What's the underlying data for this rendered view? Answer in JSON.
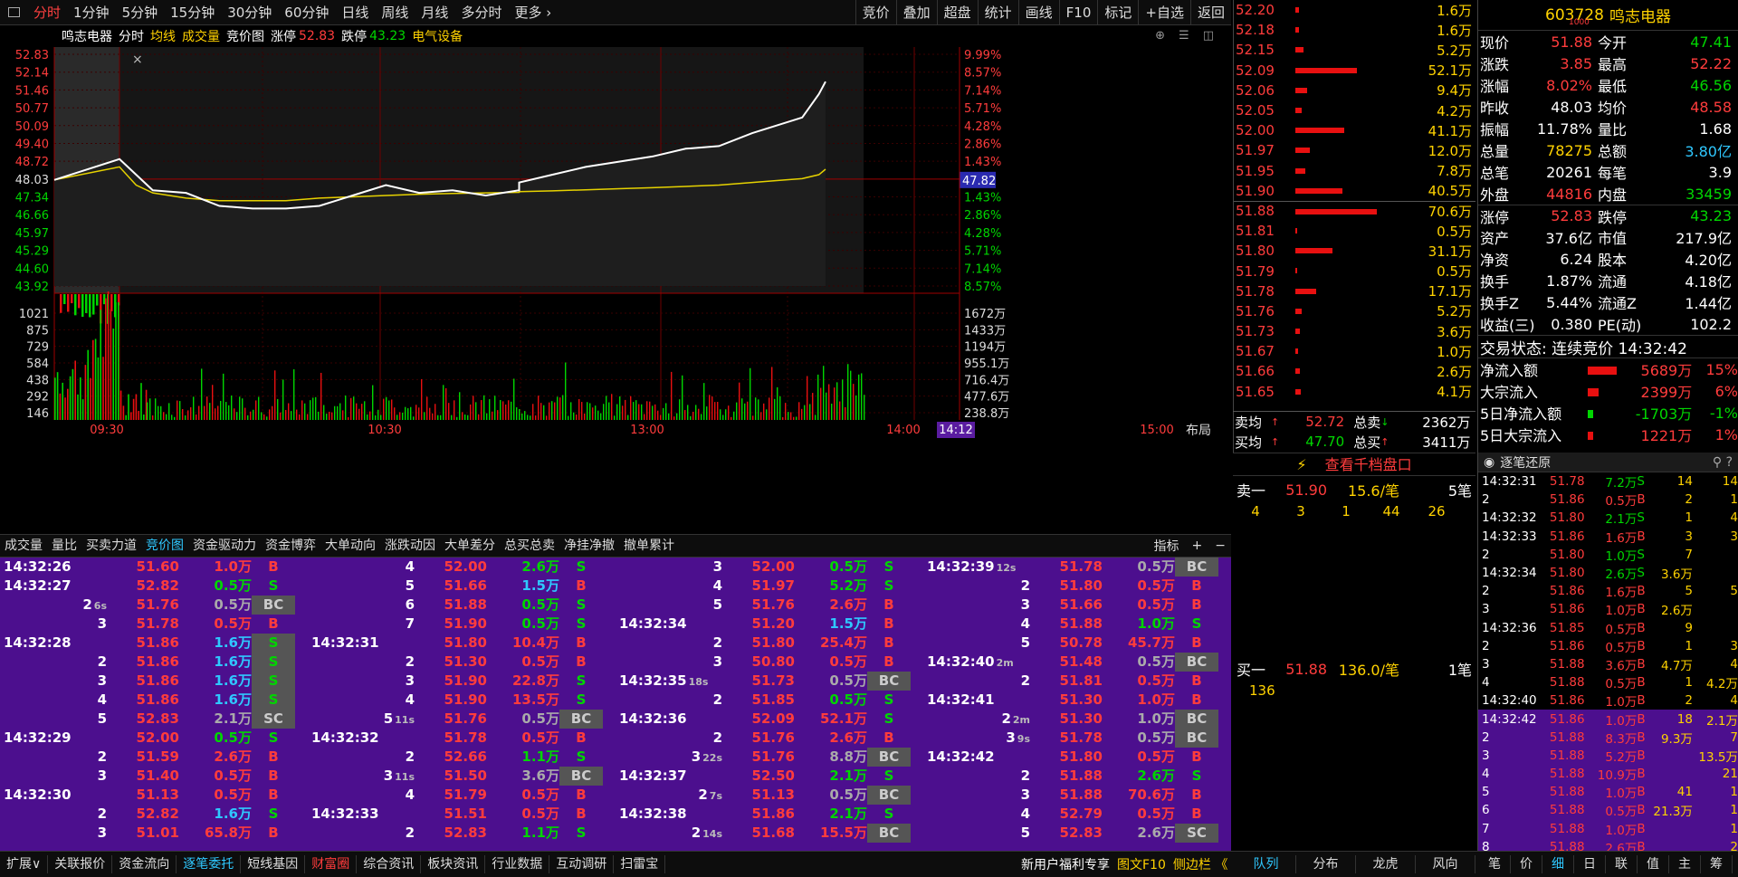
{
  "topbar": {
    "tabs": [
      "分时",
      "1分钟",
      "5分钟",
      "15分钟",
      "30分钟",
      "60分钟",
      "日线",
      "周线",
      "月线",
      "多分时",
      "更多"
    ],
    "right_tabs": [
      "竞价",
      "叠加",
      "超盘",
      "统计",
      "画线",
      "F10",
      "标记",
      "+自选",
      "返回"
    ]
  },
  "infoline": {
    "name": "鸣志电器",
    "mode": "分时",
    "avg_label": "均线",
    "vol_label": "成交量",
    "auction_label": "竞价图",
    "zt_label": "涨停",
    "zt_value": "52.83",
    "dt_label": "跌停",
    "dt_value": "43.23",
    "sector": "电气设备"
  },
  "chart": {
    "left_prices": [
      "52.83",
      "52.14",
      "51.46",
      "50.77",
      "50.09",
      "49.40",
      "48.72",
      "48.03",
      "47.34",
      "46.66",
      "45.97",
      "45.29",
      "44.60",
      "43.92"
    ],
    "right_pct": [
      "9.99%",
      "8.57%",
      "7.14%",
      "5.71%",
      "4.28%",
      "2.86%",
      "1.43%",
      "",
      "1.43%",
      "2.86%",
      "4.28%",
      "5.71%",
      "7.14%",
      "8.57%"
    ],
    "current_price_tag": "47.82",
    "vol_left": [
      "1021",
      "875",
      "729",
      "584",
      "438",
      "292",
      "146"
    ],
    "vol_right": [
      "1672万",
      "1433万",
      "1194万",
      "955.1万",
      "716.4万",
      "477.6万",
      "238.8万"
    ],
    "time_labels": [
      "09:30",
      "10:30",
      "13:00",
      "14:00",
      "14:12",
      "15:00"
    ],
    "layout_label": "布局",
    "close_label": "×"
  },
  "chart_data": {
    "type": "line",
    "title": "鸣志电器 分时",
    "prev_close": 48.03,
    "ylim": [
      43.92,
      52.83
    ],
    "series": [
      {
        "name": "分时",
        "x": [
          "09:25",
          "09:30",
          "09:35",
          "09:40",
          "09:50",
          "10:00",
          "10:10",
          "10:20",
          "10:30",
          "10:40",
          "10:50",
          "11:00",
          "11:10",
          "11:20",
          "11:30",
          "13:00",
          "13:10",
          "13:20",
          "13:30",
          "13:40",
          "13:50",
          "14:00",
          "14:10",
          "14:20",
          "14:25",
          "14:30",
          "14:32"
        ],
        "values": [
          48.0,
          48.8,
          48.2,
          47.6,
          47.5,
          47.0,
          46.9,
          46.9,
          47.0,
          47.4,
          47.8,
          47.5,
          47.6,
          47.4,
          47.6,
          47.9,
          48.2,
          48.5,
          48.7,
          48.9,
          49.2,
          49.3,
          49.8,
          50.2,
          50.4,
          51.3,
          51.78
        ]
      },
      {
        "name": "均线",
        "values": [
          48.0,
          48.5,
          47.8,
          47.5,
          47.3,
          47.2,
          47.2,
          47.2,
          47.3,
          47.35,
          47.4,
          47.45,
          47.48,
          47.5,
          47.52,
          47.55,
          47.58,
          47.62,
          47.66,
          47.7,
          47.75,
          47.8,
          47.9,
          48.0,
          48.05,
          48.2,
          48.41
        ]
      }
    ]
  },
  "bottombar": {
    "tabs": [
      "成交量",
      "量比",
      "买卖力道",
      "竞价图",
      "资金驱动力",
      "资金博弈",
      "大单动向",
      "涨跌动因",
      "大单差分",
      "总买总卖",
      "净挂净撤",
      "撤单累计"
    ],
    "right": [
      "指标",
      "+",
      "−"
    ]
  },
  "ticks": [
    [
      [
        "14:32:26",
        "51.60",
        "1.0万",
        "B"
      ],
      [
        "14:32:27",
        "52.82",
        "0.5万",
        "S"
      ],
      [
        "2",
        "51.76",
        "0.5万",
        "BC",
        "6s"
      ],
      [
        "3",
        "51.78",
        "0.5万",
        "B"
      ],
      [
        "14:32:28",
        "51.86",
        "1.6万",
        "S"
      ],
      [
        "2",
        "51.86",
        "1.6万",
        "S"
      ],
      [
        "3",
        "51.86",
        "1.6万",
        "S"
      ],
      [
        "4",
        "51.86",
        "1.6万",
        "S"
      ],
      [
        "5",
        "52.83",
        "2.1万",
        "SC"
      ],
      [
        "14:32:29",
        "52.00",
        "0.5万",
        "S"
      ],
      [
        "2",
        "51.59",
        "2.6万",
        "B"
      ],
      [
        "3",
        "51.40",
        "0.5万",
        "B"
      ],
      [
        "14:32:30",
        "51.13",
        "0.5万",
        "B"
      ],
      [
        "2",
        "52.82",
        "1.6万",
        "S"
      ],
      [
        "3",
        "51.01",
        "65.8万",
        "B"
      ]
    ],
    [
      [
        "4",
        "52.00",
        "2.6万",
        "S"
      ],
      [
        "5",
        "51.66",
        "1.5万",
        "B"
      ],
      [
        "6",
        "51.88",
        "0.5万",
        "S"
      ],
      [
        "7",
        "51.90",
        "0.5万",
        "S"
      ],
      [
        "14:32:31",
        "51.80",
        "10.4万",
        "B"
      ],
      [
        "2",
        "51.30",
        "0.5万",
        "B"
      ],
      [
        "3",
        "51.90",
        "22.8万",
        "S"
      ],
      [
        "4",
        "51.90",
        "13.5万",
        "S"
      ],
      [
        "5",
        "51.76",
        "0.5万",
        "BC",
        "11s"
      ],
      [
        "14:32:32",
        "51.78",
        "0.5万",
        "B"
      ],
      [
        "2",
        "52.66",
        "1.1万",
        "S"
      ],
      [
        "3",
        "51.50",
        "3.6万",
        "BC",
        "11s"
      ],
      [
        "4",
        "51.79",
        "0.5万",
        "B"
      ],
      [
        "14:32:33",
        "51.51",
        "0.5万",
        "B"
      ],
      [
        "2",
        "52.83",
        "1.1万",
        "S"
      ]
    ],
    [
      [
        "3",
        "52.00",
        "0.5万",
        "S"
      ],
      [
        "4",
        "51.97",
        "5.2万",
        "S"
      ],
      [
        "5",
        "51.76",
        "2.6万",
        "B"
      ],
      [
        "14:32:34",
        "51.20",
        "1.5万",
        "B"
      ],
      [
        "2",
        "51.80",
        "25.4万",
        "B"
      ],
      [
        "3",
        "50.80",
        "0.5万",
        "B"
      ],
      [
        "14:32:35",
        "51.73",
        "0.5万",
        "BC",
        "18s"
      ],
      [
        "2",
        "51.85",
        "0.5万",
        "S"
      ],
      [
        "14:32:36",
        "52.09",
        "52.1万",
        "S"
      ],
      [
        "2",
        "51.76",
        "2.6万",
        "B"
      ],
      [
        "3",
        "51.76",
        "8.8万",
        "BC",
        "22s"
      ],
      [
        "14:32:37",
        "52.50",
        "2.1万",
        "S"
      ],
      [
        "2",
        "51.13",
        "0.5万",
        "BC",
        "7s"
      ],
      [
        "14:32:38",
        "51.86",
        "2.1万",
        "S"
      ],
      [
        "2",
        "51.68",
        "15.5万",
        "BC",
        "14s"
      ]
    ],
    [
      [
        "14:32:39",
        "51.78",
        "0.5万",
        "BC",
        "12s"
      ],
      [
        "2",
        "51.80",
        "0.5万",
        "B"
      ],
      [
        "3",
        "51.66",
        "0.5万",
        "B"
      ],
      [
        "4",
        "51.88",
        "1.0万",
        "S"
      ],
      [
        "5",
        "50.78",
        "45.7万",
        "B"
      ],
      [
        "14:32:40",
        "51.48",
        "0.5万",
        "BC",
        "2m"
      ],
      [
        "2",
        "51.81",
        "0.5万",
        "B"
      ],
      [
        "14:32:41",
        "51.30",
        "1.0万",
        "B"
      ],
      [
        "2",
        "51.30",
        "1.0万",
        "BC",
        "2m"
      ],
      [
        "3",
        "51.78",
        "0.5万",
        "BC",
        "9s"
      ],
      [
        "14:32:42",
        "51.80",
        "0.5万",
        "B"
      ],
      [
        "2",
        "51.88",
        "2.6万",
        "S"
      ],
      [
        "3",
        "51.88",
        "70.6万",
        "B"
      ],
      [
        "4",
        "52.79",
        "0.5万",
        "B"
      ],
      [
        "5",
        "52.83",
        "2.6万",
        "SC"
      ]
    ]
  ],
  "orderbook": [
    [
      "52.20",
      "1.6万",
      4
    ],
    [
      "52.18",
      "1.6万",
      4
    ],
    [
      "52.15",
      "5.2万",
      10
    ],
    [
      "52.09",
      "52.1万",
      75
    ],
    [
      "52.06",
      "9.4万",
      14
    ],
    [
      "52.05",
      "4.2万",
      8
    ],
    [
      "52.00",
      "41.1万",
      60
    ],
    [
      "51.97",
      "12.0万",
      18
    ],
    [
      "51.95",
      "7.8万",
      12
    ],
    [
      "51.90",
      "40.5万",
      58
    ],
    [
      "51.88",
      "70.6万",
      100
    ],
    [
      "51.81",
      "0.5万",
      2
    ],
    [
      "51.80",
      "31.1万",
      46
    ],
    [
      "51.79",
      "0.5万",
      2
    ],
    [
      "51.78",
      "17.1万",
      26
    ],
    [
      "51.76",
      "5.2万",
      8
    ],
    [
      "51.73",
      "3.6万",
      6
    ],
    [
      "51.67",
      "1.0万",
      3
    ],
    [
      "51.66",
      "2.6万",
      5
    ],
    [
      "51.65",
      "4.1万",
      7
    ]
  ],
  "avgs": {
    "sell_avg_l": "卖均",
    "sell_avg": "52.72",
    "sell_total_l": "总卖",
    "sell_total": "2362万",
    "buy_avg_l": "买均",
    "buy_avg": "47.70",
    "buy_total_l": "总买",
    "buy_total": "3411万"
  },
  "qian_link": "查看千档盘口",
  "queue": {
    "sell1_label": "卖一",
    "sell1_price": "51.90",
    "sell1_per": "15.6/笔",
    "sell1_count": "5笔",
    "sell_items": [
      "4",
      "3",
      "1",
      "44",
      "26"
    ],
    "buy1_label": "买一",
    "buy1_price": "51.88",
    "buy1_per": "136.0/笔",
    "buy1_count": "1笔",
    "buy_items": [
      "136"
    ]
  },
  "quote": {
    "code": "603728",
    "name": "鸣志电器",
    "small": "1000",
    "rows": [
      [
        "现价",
        "51.88",
        "今开",
        "47.41"
      ],
      [
        "涨跌",
        "3.85",
        "最高",
        "52.22"
      ],
      [
        "涨幅",
        "8.02%",
        "最低",
        "46.56"
      ],
      [
        "昨收",
        "48.03",
        "均价",
        "48.58"
      ],
      [
        "振幅",
        "11.78%",
        "量比",
        "1.68"
      ],
      [
        "总量",
        "78275",
        "总额",
        "3.80亿"
      ],
      [
        "总笔",
        "20261",
        "每笔",
        "3.9"
      ],
      [
        "外盘",
        "44816",
        "内盘",
        "33459"
      ],
      [
        "涨停",
        "52.83",
        "跌停",
        "43.23"
      ],
      [
        "资产",
        "37.6亿",
        "市值",
        "217.9亿"
      ],
      [
        "净资",
        "6.24",
        "股本",
        "4.20亿"
      ],
      [
        "换手",
        "1.87%",
        "流通",
        "4.18亿"
      ],
      [
        "换手Z",
        "5.44%",
        "流通Z",
        "1.44亿"
      ],
      [
        "收益(三)",
        "0.380",
        "PE(动)",
        "102.2"
      ]
    ],
    "trade_state": "交易状态: 连续竞价 14:32:42",
    "flows": [
      [
        "净流入额",
        "5689万",
        "15%",
        32
      ],
      [
        "大宗流入",
        "2399万",
        "6%",
        12
      ],
      [
        "5日净流入额",
        "-1703万",
        "-1%",
        6
      ],
      [
        "5日大宗流入",
        "1221万",
        "1%",
        6
      ]
    ]
  },
  "tickhist": {
    "header": "逐笔还原",
    "rows": [
      [
        "14:32:31",
        "51.78",
        "7.2万",
        "S",
        "14",
        "14"
      ],
      [
        "2",
        "51.86",
        "0.5万",
        "B",
        "2",
        "1"
      ],
      [
        "14:32:32",
        "51.80",
        "2.1万",
        "S",
        "1",
        "4"
      ],
      [
        "14:32:33",
        "51.86",
        "1.6万",
        "B",
        "3",
        "3"
      ],
      [
        "2",
        "51.80",
        "1.0万",
        "S",
        "7",
        ""
      ],
      [
        "14:32:34",
        "51.80",
        "2.6万",
        "S",
        "3.6万",
        ""
      ],
      [
        "2",
        "51.86",
        "1.6万",
        "B",
        "5",
        "5"
      ],
      [
        "3",
        "51.86",
        "1.0万",
        "B",
        "2.6万",
        ""
      ],
      [
        "14:32:36",
        "51.85",
        "0.5万",
        "B",
        "9",
        ""
      ],
      [
        "2",
        "51.86",
        "0.5万",
        "B",
        "1",
        "3"
      ],
      [
        "3",
        "51.88",
        "3.6万",
        "B",
        "4.7万",
        "4"
      ],
      [
        "4",
        "51.88",
        "0.5万",
        "B",
        "1",
        "4.2万"
      ],
      [
        "14:32:40",
        "51.86",
        "1.0万",
        "B",
        "2",
        "4"
      ],
      [
        "14:32:42",
        "51.86",
        "1.0万",
        "B",
        "18",
        "2.1万"
      ],
      [
        "2",
        "51.88",
        "8.3万",
        "B",
        "9.3万",
        "7"
      ],
      [
        "3",
        "51.88",
        "5.2万",
        "B",
        "",
        "13.5万"
      ],
      [
        "4",
        "51.88",
        "10.9万",
        "B",
        "",
        "21"
      ],
      [
        "5",
        "51.88",
        "1.0万",
        "B",
        "41",
        "1"
      ],
      [
        "6",
        "51.88",
        "0.5万",
        "B",
        "21.3万",
        "1"
      ],
      [
        "7",
        "51.88",
        "1.0万",
        "B",
        "",
        "1"
      ],
      [
        "8",
        "51.88",
        "2.6万",
        "B",
        "",
        "2"
      ]
    ]
  },
  "statusbar": {
    "left": [
      "扩展∨",
      "关联报价",
      "资金流向",
      "逐笔委托",
      "短线基因",
      "财富圈",
      "综合资讯",
      "板块资讯",
      "行业数据",
      "互动调研",
      "扫雷宝"
    ],
    "promo": "新用户福利专享",
    "f10": "图文F10",
    "side": "侧边栏 《",
    "mid": [
      "队列",
      "分布",
      "龙虎",
      "风向"
    ],
    "right": [
      "笔",
      "价",
      "细",
      "日",
      "联",
      "值",
      "主",
      "筹"
    ]
  }
}
